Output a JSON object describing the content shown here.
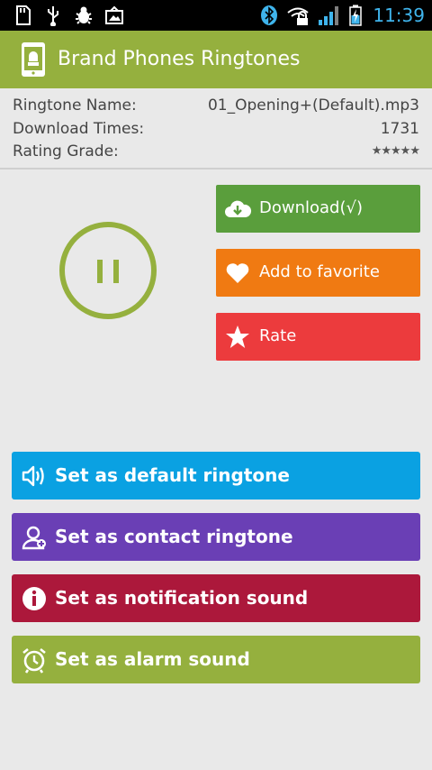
{
  "status_bar": {
    "time": "11:39",
    "left_icons": [
      "sd-card-icon",
      "usb-icon",
      "debug-icon",
      "photo-icon"
    ],
    "right_icons": [
      "bluetooth-icon",
      "wifi-icon",
      "signal-icon",
      "battery-icon"
    ]
  },
  "action_bar": {
    "title": "Brand Phones Ringtones",
    "icon": "android-phone-icon"
  },
  "info": {
    "name_label": "Ringtone Name:",
    "name_value": "01_Opening+(Default).mp3",
    "downloads_label": "Download Times:",
    "downloads_value": "1731",
    "rating_label": "Rating Grade:",
    "rating_value": "★★★★★"
  },
  "player": {
    "state": "playing",
    "control_icon": "pause-icon"
  },
  "side_buttons": {
    "download_label": "Download(√)",
    "favorite_label": "Add to favorite",
    "rate_label": "Rate"
  },
  "actions": {
    "default_label": "Set as default ringtone",
    "contact_label": "Set as contact ringtone",
    "notification_label": "Set as notification sound",
    "alarm_label": "Set as alarm sound"
  },
  "colors": {
    "accent": "#95b03e",
    "download": "#5a9e3c",
    "favorite": "#f07a12",
    "rate": "#ec3b3d",
    "default_ringtone": "#0aa1e2",
    "contact_ringtone": "#6a3fb5",
    "notification": "#ac183b",
    "alarm": "#95b03e"
  }
}
